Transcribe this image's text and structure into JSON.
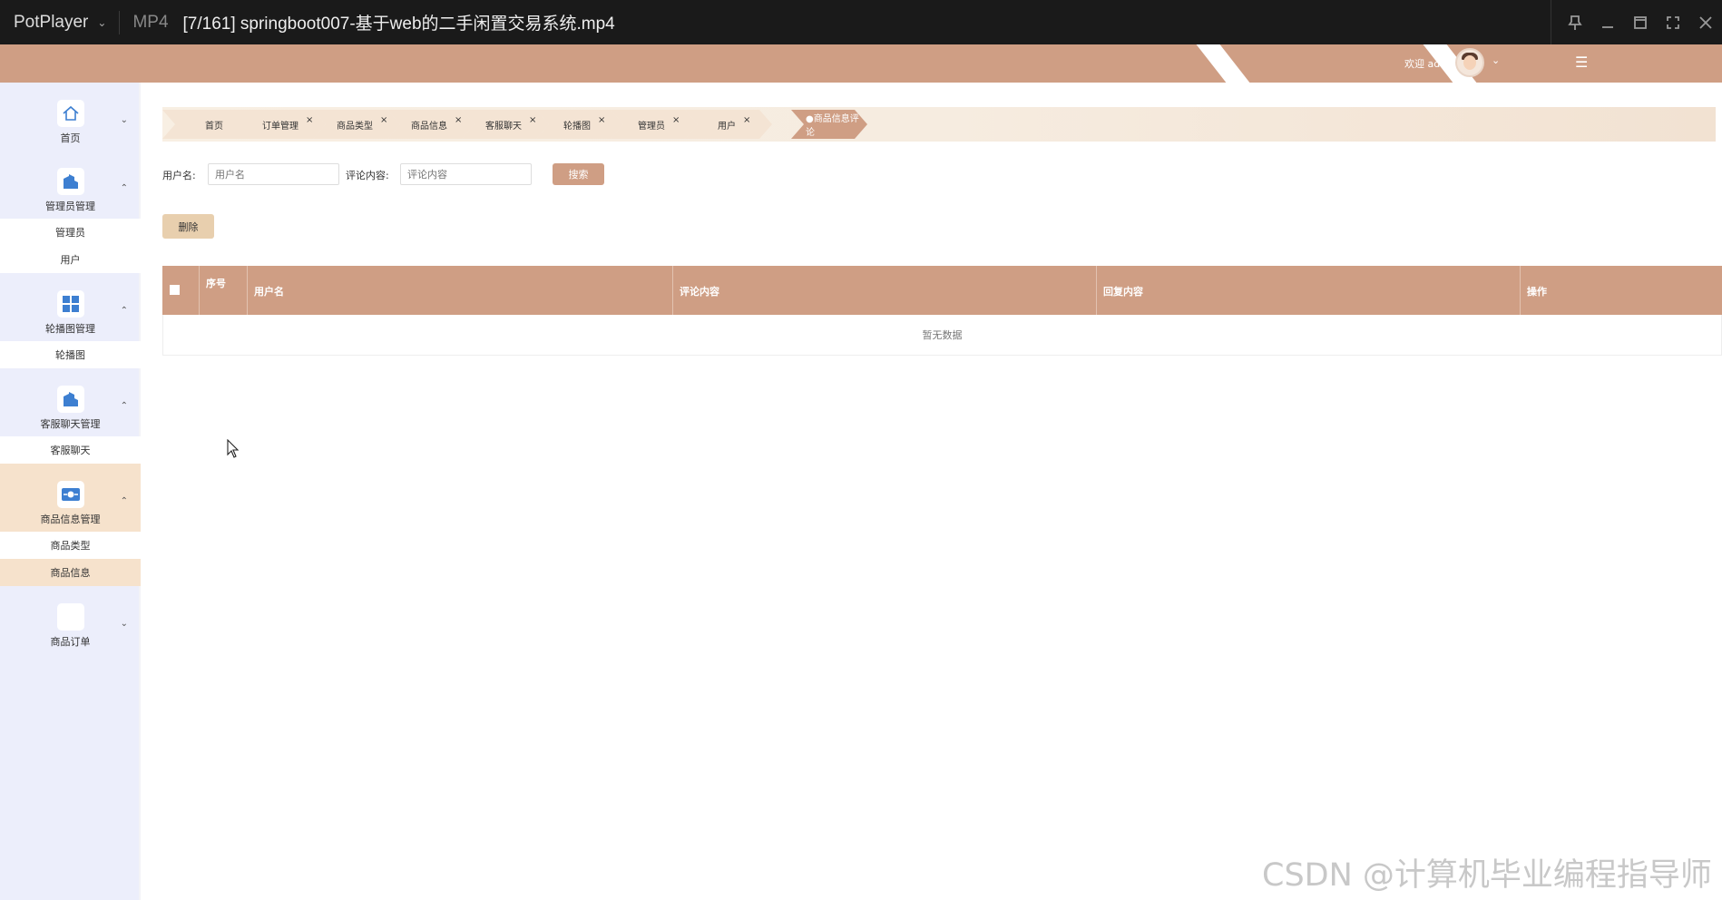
{
  "player": {
    "app_name": "PotPlayer",
    "format": "MP4",
    "file_title": "[7/161] springboot007-基于web的二手闲置交易系统.mp4"
  },
  "header": {
    "welcome_text": "欢迎 admin",
    "colors": {
      "bar": "#cf9e84",
      "accent": "#cf9e84",
      "tab_bg": "#f4e4d4"
    }
  },
  "sidebar": {
    "groups": [
      {
        "label": "首页",
        "icon": "home-icon",
        "subitems": []
      },
      {
        "label": "管理员管理",
        "icon": "building-icon",
        "subitems": [
          "管理员",
          "用户"
        ]
      },
      {
        "label": "轮播图管理",
        "icon": "grid-icon",
        "subitems": [
          "轮播图"
        ]
      },
      {
        "label": "客服聊天管理",
        "icon": "building-icon",
        "subitems": [
          "客服聊天"
        ]
      },
      {
        "label": "商品信息管理",
        "icon": "card-icon",
        "subitems": [
          "商品类型",
          "商品信息"
        ]
      },
      {
        "label": "商品订单",
        "icon": "blank-icon",
        "subitems": []
      }
    ]
  },
  "tabs": [
    {
      "label": "首页",
      "closable": false
    },
    {
      "label": "订单管理",
      "closable": true
    },
    {
      "label": "商品类型",
      "closable": true
    },
    {
      "label": "商品信息",
      "closable": true
    },
    {
      "label": "客服聊天",
      "closable": true
    },
    {
      "label": "轮播图",
      "closable": true
    },
    {
      "label": "管理员",
      "closable": true
    },
    {
      "label": "用户",
      "closable": true
    },
    {
      "label": "●商品信息评论",
      "closable": false,
      "active": true
    }
  ],
  "search": {
    "username_label": "用户名:",
    "username_placeholder": "用户名",
    "comment_label": "评论内容:",
    "comment_placeholder": "评论内容",
    "search_button": "搜索"
  },
  "actions": {
    "delete_button": "删除"
  },
  "table": {
    "columns": [
      "序号",
      "用户名",
      "评论内容",
      "回复内容",
      "操作"
    ],
    "rows": [],
    "empty_text": "暂无数据"
  },
  "watermark": "CSDN @计算机毕业编程指导师"
}
